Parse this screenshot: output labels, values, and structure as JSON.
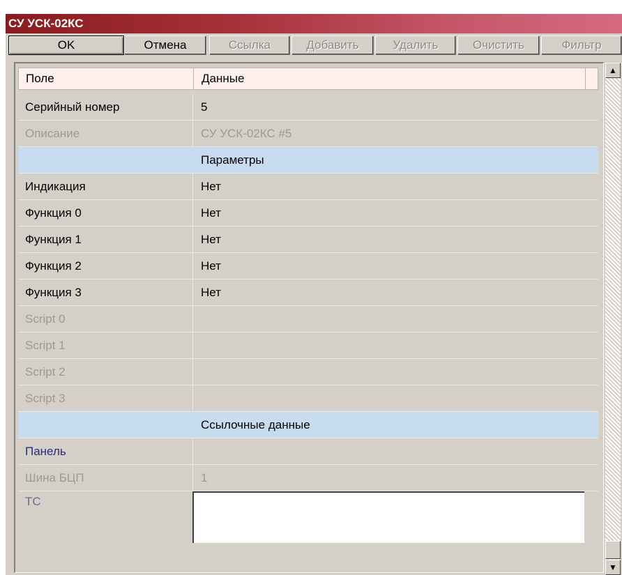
{
  "window": {
    "title": "СУ УСК-02КС"
  },
  "toolbar": {
    "ok": "OK",
    "cancel": "Отмена",
    "link": "Ссылка",
    "add": "Добавить",
    "delete": "Удалить",
    "clear": "Очистить",
    "filter": "Фильтр"
  },
  "grid": {
    "header": {
      "field": "Поле",
      "data": "Данные"
    },
    "rows": [
      {
        "key": "Серийный номер",
        "value": "5"
      },
      {
        "key": "Описание",
        "value": "СУ УСК-02КС #5"
      },
      {
        "key": "",
        "value": "Параметры"
      },
      {
        "key": "Индикация",
        "value": "Нет"
      },
      {
        "key": "Функция 0",
        "value": "Нет"
      },
      {
        "key": "Функция 1",
        "value": "Нет"
      },
      {
        "key": "Функция 2",
        "value": "Нет"
      },
      {
        "key": "Функция 3",
        "value": "Нет"
      },
      {
        "key": "Script 0",
        "value": ""
      },
      {
        "key": "Script 1",
        "value": ""
      },
      {
        "key": "Script 2",
        "value": ""
      },
      {
        "key": "Script 3",
        "value": ""
      },
      {
        "key": "",
        "value": "Ссылочные данные"
      },
      {
        "key": "Панель",
        "value": ""
      },
      {
        "key": "Шина БЦП",
        "value": "1"
      },
      {
        "key": "ТС",
        "value": ""
      }
    ]
  },
  "scrollbar": {
    "up_icon": "▲",
    "down_icon": "▼"
  },
  "colors": {
    "title_start": "#8a1b1d",
    "title_end": "#d46a80",
    "section_bg": "#c8dcf0",
    "header_bg": "#fff0ee"
  }
}
